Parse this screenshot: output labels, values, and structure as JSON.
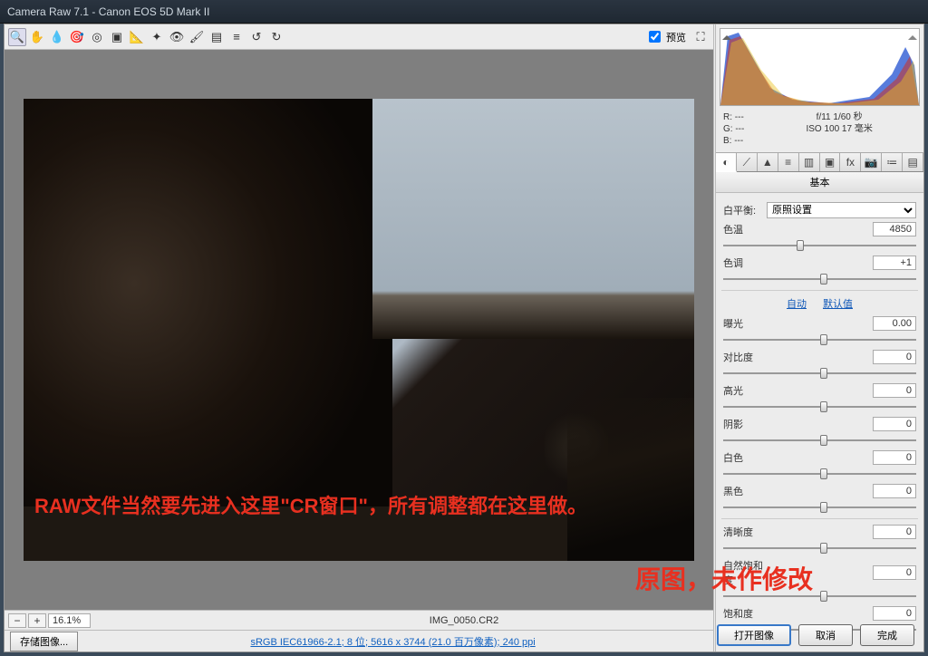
{
  "title": "Camera Raw 7.1  -  Canon EOS 5D Mark II",
  "preview_label": "预览",
  "zoom": {
    "value": "16.1%"
  },
  "filename": "IMG_0050.CR2",
  "save_image": "存储图像...",
  "profile_link": "sRGB IEC61966-2.1; 8 位; 5616 x 3744 (21.0 百万像素); 240 ppi",
  "buttons": {
    "open": "打开图像",
    "cancel": "取消",
    "done": "完成"
  },
  "meta": {
    "r": "R:  ---",
    "g": "G:  ---",
    "b": "B:  ---",
    "exp1": "f/11  1/60 秒",
    "exp2": "ISO 100  17 毫米"
  },
  "panel_title": "基本",
  "wb": {
    "label": "白平衡:",
    "value": "原照设置"
  },
  "temp": {
    "label": "色温",
    "value": "4850"
  },
  "tint": {
    "label": "色调",
    "value": "+1"
  },
  "auto": "自动",
  "default": "默认值",
  "sliders": {
    "exposure": {
      "label": "曝光",
      "value": "0.00"
    },
    "contrast": {
      "label": "对比度",
      "value": "0"
    },
    "highlights": {
      "label": "高光",
      "value": "0"
    },
    "shadows": {
      "label": "阴影",
      "value": "0"
    },
    "whites": {
      "label": "白色",
      "value": "0"
    },
    "blacks": {
      "label": "黑色",
      "value": "0"
    },
    "clarity": {
      "label": "清晰度",
      "value": "0"
    },
    "vibrance": {
      "label": "自然饱和度",
      "value": "0"
    },
    "saturation": {
      "label": "饱和度",
      "value": "0"
    }
  },
  "annot1": "RAW文件当然要先进入这里\"CR窗口\"，所有调整都在这里做。",
  "annot2": "原图，未作修改"
}
